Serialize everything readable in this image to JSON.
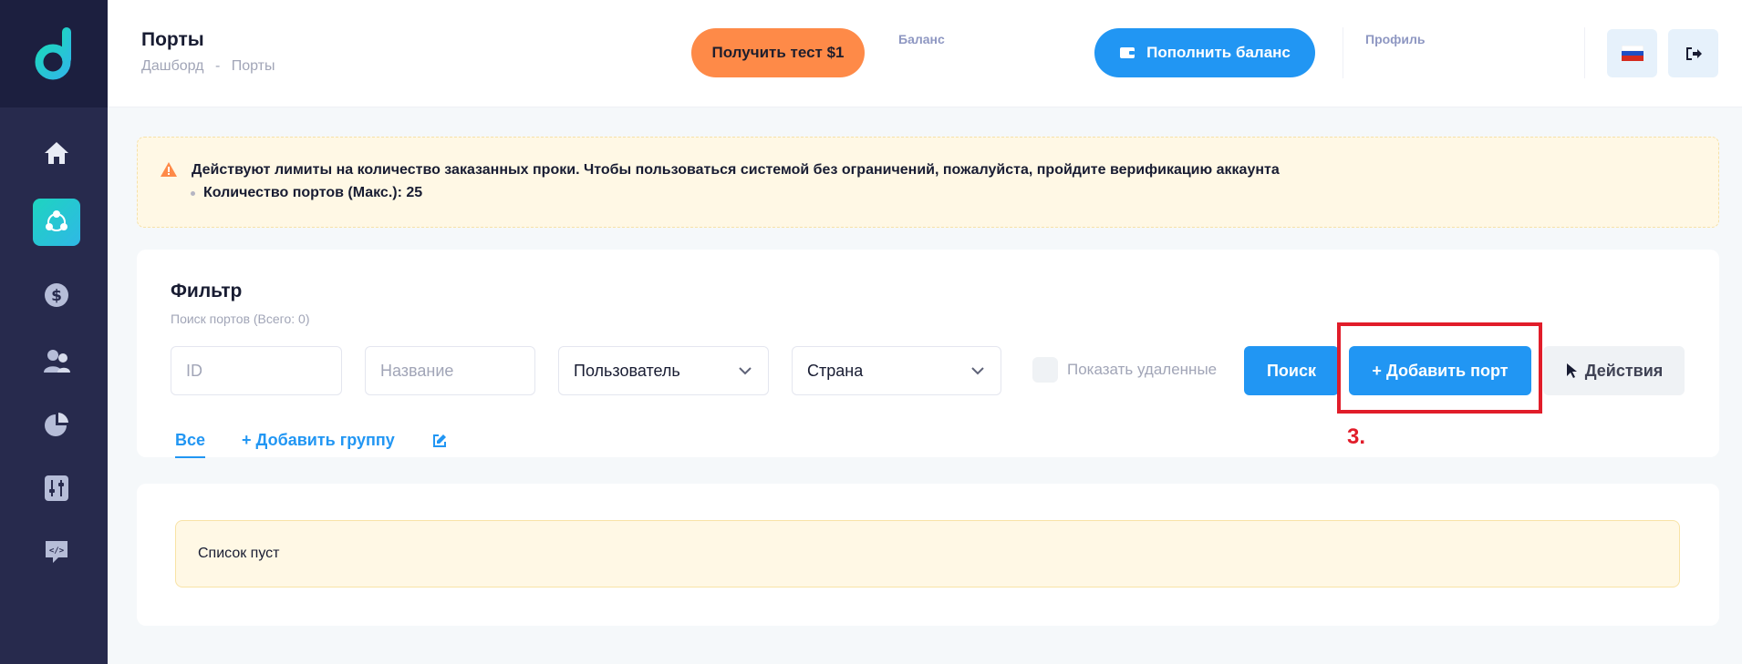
{
  "header": {
    "title": "Порты",
    "breadcrumb": [
      "Дашборд",
      "-",
      "Порты"
    ],
    "test_button": "Получить тест $1",
    "balance_label": "Баланс",
    "topup_button": "Пополнить баланс",
    "profile_label": "Профиль"
  },
  "sidebar": {
    "items": [
      "home-icon",
      "network-icon",
      "dollar-icon",
      "users-icon",
      "pie-chart-icon",
      "sliders-icon",
      "api-icon"
    ],
    "active": "network-icon"
  },
  "alert": {
    "message": "Действуют лимиты на количество заказанных проки. Чтобы пользоваться системой без ограничений, пожалуйста, пройдите верификацию аккаунта",
    "limit": "Количество портов (Макс.): 25"
  },
  "filter": {
    "title": "Фильтр",
    "subtitle": "Поиск портов (Всего: 0)",
    "id_placeholder": "ID",
    "name_placeholder": "Название",
    "user_select": "Пользователь",
    "country_select": "Страна",
    "show_deleted": "Показать удаленные",
    "search_button": "Поиск",
    "add_port_button": "Добавить порт",
    "actions_button": "Действия",
    "step_annotation": "3."
  },
  "tabs": {
    "all": "Все",
    "add_group": "Добавить группу"
  },
  "list": {
    "empty": "Список пуст"
  },
  "colors": {
    "sidebar": "#272a4d",
    "primary": "#2196f3",
    "orange": "#fe8a48",
    "highlight": "#e11d2a"
  }
}
